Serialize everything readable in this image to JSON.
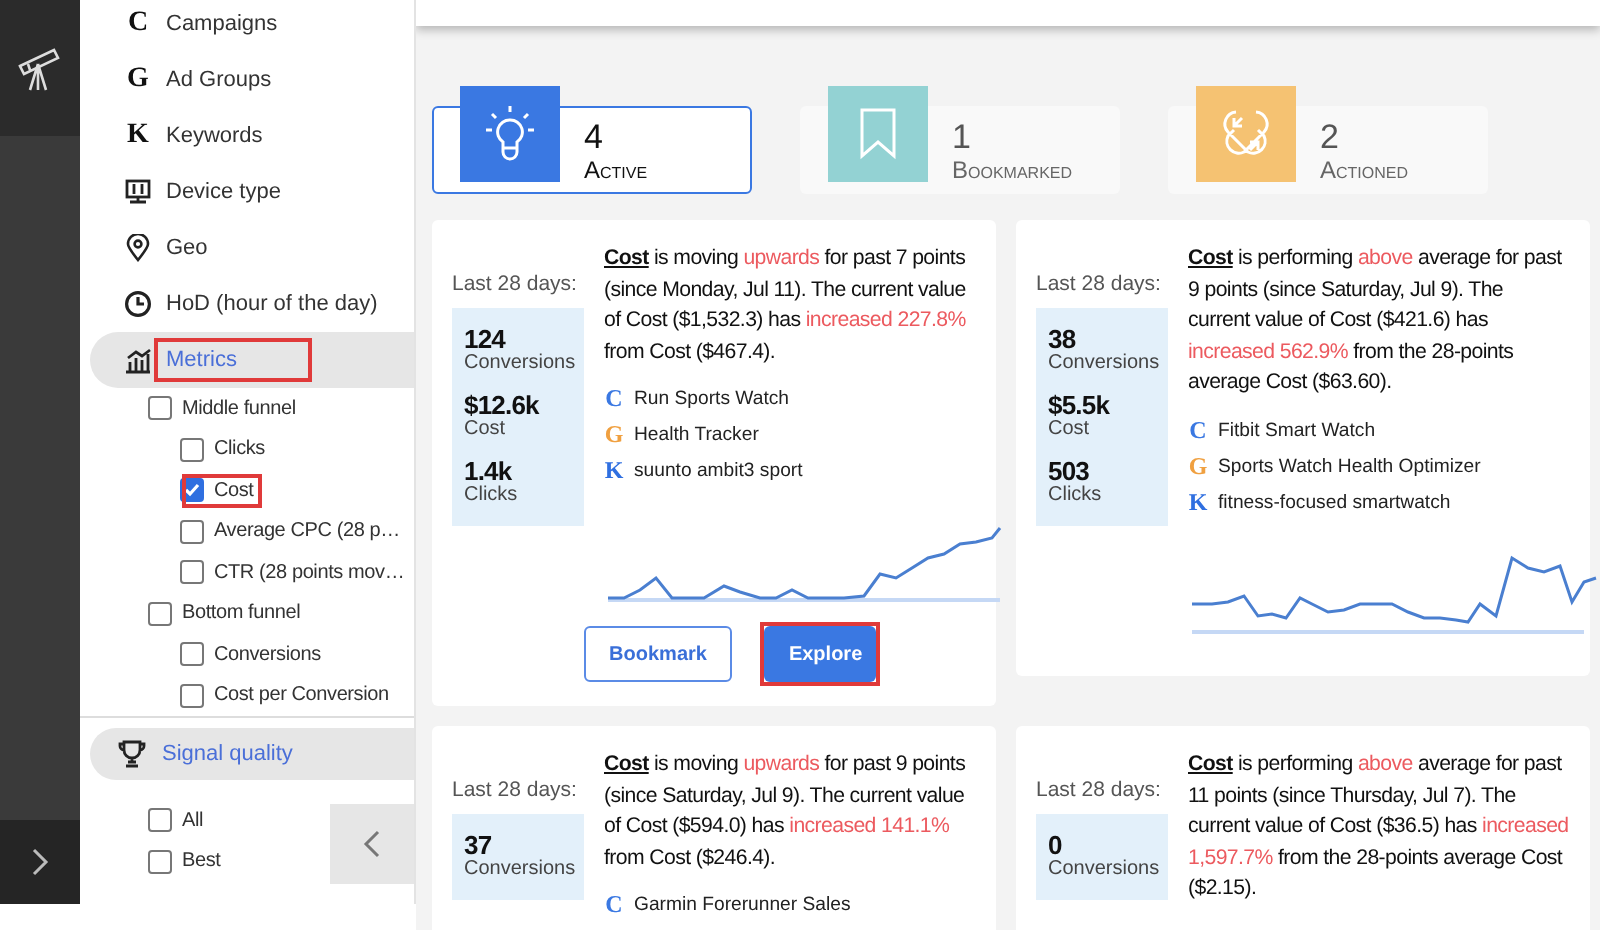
{
  "sidebar": {
    "nav": [
      {
        "kind": "letter",
        "icon": "C",
        "label": "Campaigns",
        "selected": false
      },
      {
        "kind": "letter",
        "icon": "G",
        "label": "Ad Groups",
        "selected": false
      },
      {
        "kind": "letter",
        "icon": "K",
        "label": "Keywords",
        "selected": false
      },
      {
        "kind": "device",
        "label": "Device type",
        "selected": false
      },
      {
        "kind": "geo",
        "label": "Geo",
        "selected": false
      },
      {
        "kind": "clock",
        "label": "HoD (hour of the day)",
        "selected": false
      },
      {
        "kind": "metrics",
        "label": "Metrics",
        "selected": true,
        "highlighted": true,
        "children": [
          {
            "label": "Middle funnel",
            "checked": false,
            "highlighted": false,
            "children": [
              {
                "label": "Clicks",
                "checked": false,
                "highlighted": false
              },
              {
                "label": "Cost",
                "checked": true,
                "highlighted": true
              },
              {
                "label": "Average CPC (28 p…",
                "checked": false,
                "highlighted": false
              },
              {
                "label": "CTR (28 points mov…",
                "checked": false,
                "highlighted": false
              }
            ]
          },
          {
            "label": "Bottom funnel",
            "checked": false,
            "highlighted": false,
            "children": [
              {
                "label": "Conversions",
                "checked": false,
                "highlighted": false
              },
              {
                "label": "Cost per Conversion",
                "checked": false,
                "highlighted": false
              }
            ]
          }
        ]
      }
    ],
    "signal_quality": {
      "label": "Signal quality",
      "options": [
        {
          "label": "All",
          "checked": false
        },
        {
          "label": "Best",
          "checked": false
        }
      ]
    }
  },
  "stats": [
    {
      "kind": "idea",
      "count": "4",
      "label": "Active",
      "selected": true,
      "color": "#3a78e2"
    },
    {
      "kind": "bookmark",
      "count": "1",
      "label": "Bookmarked",
      "selected": false,
      "color": "#93d2d3"
    },
    {
      "kind": "actioned",
      "count": "2",
      "label": "Actioned",
      "selected": false,
      "color": "#f5c272"
    }
  ],
  "cards": [
    {
      "period": "Last 28 days:",
      "metrics": [
        {
          "value": "124",
          "label": "Conversions"
        },
        {
          "value": "$12.6k",
          "label": "Cost"
        },
        {
          "value": "1.4k",
          "label": "Clicks"
        }
      ],
      "insight": [
        {
          "kind": "metric",
          "text": "Cost"
        },
        {
          "kind": "text",
          "text": " is moving "
        },
        {
          "kind": "alert",
          "text": "upwards"
        },
        {
          "kind": "text",
          "text": " for past 7 points (since Monday, Jul 11). The current value of Cost ($1,532.3) has "
        },
        {
          "kind": "alert",
          "text": "increased 227.8%"
        },
        {
          "kind": "text",
          "text": " from Cost ($467.4)."
        }
      ],
      "entities": [
        {
          "kind": "campaign",
          "letter": "C",
          "name": "Run Sports Watch"
        },
        {
          "kind": "adgroup",
          "letter": "G",
          "name": "Health Tracker"
        },
        {
          "kind": "keyword",
          "letter": "K",
          "name": "suunto ambit3 sport"
        }
      ],
      "buttons": [
        {
          "kind": "outline",
          "label": "Bookmark",
          "highlighted": false
        },
        {
          "kind": "primary",
          "label": "Explore",
          "highlighted": true
        }
      ]
    },
    {
      "period": "Last 28 days:",
      "metrics": [
        {
          "value": "38",
          "label": "Conversions"
        },
        {
          "value": "$5.5k",
          "label": "Cost"
        },
        {
          "value": "503",
          "label": "Clicks"
        }
      ],
      "insight": [
        {
          "kind": "metric",
          "text": "Cost"
        },
        {
          "kind": "text",
          "text": " is performing "
        },
        {
          "kind": "alert",
          "text": "above"
        },
        {
          "kind": "text",
          "text": " average for past 9 points (since Saturday, Jul 9). The current value of Cost ($421.6) has "
        },
        {
          "kind": "alert",
          "text": "increased 562.9%"
        },
        {
          "kind": "text",
          "text": " from the 28-points average Cost ($63.60)."
        }
      ],
      "entities": [
        {
          "kind": "campaign",
          "letter": "C",
          "name": "Fitbit Smart Watch"
        },
        {
          "kind": "adgroup",
          "letter": "G",
          "name": "Sports Watch Health Optimizer"
        },
        {
          "kind": "keyword",
          "letter": "K",
          "name": "fitness-focused smartwatch"
        }
      ]
    },
    {
      "period": "Last 28 days:",
      "metrics": [
        {
          "value": "37",
          "label": "Conversions"
        }
      ],
      "insight": [
        {
          "kind": "metric",
          "text": "Cost"
        },
        {
          "kind": "text",
          "text": " is moving "
        },
        {
          "kind": "alert",
          "text": "upwards"
        },
        {
          "kind": "text",
          "text": " for past 9 points (since Saturday, Jul 9). The current value of Cost ($594.0) has "
        },
        {
          "kind": "alert",
          "text": "increased 141.1%"
        },
        {
          "kind": "text",
          "text": " from Cost ($246.4)."
        }
      ],
      "entities": [
        {
          "kind": "campaign",
          "letter": "C",
          "name": "Garmin Forerunner Sales"
        }
      ]
    },
    {
      "period": "Last 28 days:",
      "metrics": [
        {
          "value": "0",
          "label": "Conversions"
        }
      ],
      "insight": [
        {
          "kind": "metric",
          "text": "Cost"
        },
        {
          "kind": "text",
          "text": " is performing "
        },
        {
          "kind": "alert",
          "text": "above"
        },
        {
          "kind": "text",
          "text": " average for past 11 points (since Thursday, Jul 7). The current value of Cost ($36.5) has "
        },
        {
          "kind": "alert",
          "text": "increased 1,597.7%"
        },
        {
          "kind": "text",
          "text": " from the 28-points average Cost ($2.15)."
        }
      ]
    }
  ]
}
